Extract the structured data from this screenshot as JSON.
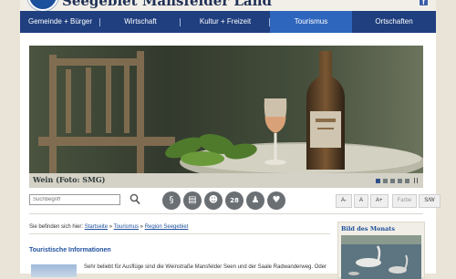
{
  "header": {
    "site_title": "Seegebiet Mansfelder Land",
    "facebook_label": "f"
  },
  "nav": {
    "items": [
      "Gemeinde + Bürger",
      "Wirtschaft",
      "Kultur + Freizeit",
      "Tourismus",
      "Ortschaften"
    ],
    "active_index": 3
  },
  "hero": {
    "caption": "Wein (Foto: SMG)",
    "slide_count": 5,
    "active_slide": 1
  },
  "toolbar": {
    "search_placeholder": "Suchbegriff",
    "icons": [
      "paragraph-icon",
      "form-icon",
      "group-icon",
      "calendar-icon",
      "people-icon",
      "heart-icon"
    ],
    "calendar_day": "28",
    "font_sizes": [
      "A-",
      "A",
      "A+"
    ],
    "contrast_label": "Farbe",
    "bw_label": "S/W"
  },
  "breadcrumb": {
    "prefix": "Sie befinden sich hier:",
    "items": [
      "Startseite",
      "Tourismus",
      "Region Seegebiet"
    ],
    "separator": "»"
  },
  "main": {
    "section_title": "Touristische Informationen",
    "intro_text": "Sehr beliebt für Ausflüge sind die Weinstraße Mansfelder Seen und der Saale Radwanderweg. Oder"
  },
  "sidebar": {
    "title": "Bild des Monats"
  },
  "colors": {
    "nav_bg": "#1f3f7f",
    "nav_active": "#2f66bd",
    "link": "#1f4f9c",
    "page_bg": "#e9e4d7"
  }
}
